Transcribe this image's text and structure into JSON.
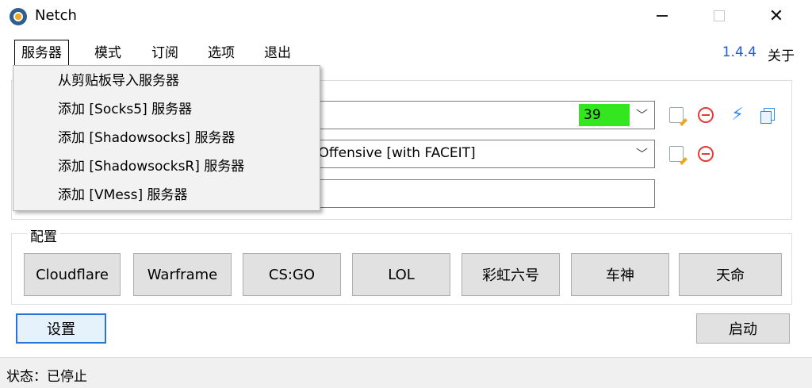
{
  "window": {
    "title": "Netch",
    "minimize": "—",
    "close": "✕"
  },
  "menubar": {
    "items": [
      "服务器",
      "模式",
      "订阅",
      "选项",
      "退出"
    ],
    "version": "1.4.4",
    "about": "关于"
  },
  "server_menu": {
    "items": [
      "从剪贴板导入服务器",
      "添加 [Socks5] 服务器",
      "添加 [Shadowsocks] 服务器",
      "添加 [ShadowsocksR] 服务器",
      "添加 [VMess] 服务器"
    ]
  },
  "server_combo": {
    "text": "",
    "delay": "39",
    "delay_color": "#33e61f",
    "arrow": "﹀"
  },
  "mode_combo": {
    "text": "al Offensive [with FACEIT]",
    "arrow": "﹀"
  },
  "remark_input": {
    "value": ""
  },
  "config": {
    "label": "配置",
    "buttons": [
      "Cloudflare",
      "Warframe",
      "CS:GO",
      "LOL",
      "彩虹六号",
      "车神",
      "天命"
    ]
  },
  "buttons": {
    "settings": "设置",
    "start": "启动"
  },
  "status": {
    "text": "状态：已停止"
  },
  "icons": {
    "edit": "edit-icon",
    "remove": "remove-icon",
    "speed": "⚡",
    "copy": "copy-icon"
  }
}
